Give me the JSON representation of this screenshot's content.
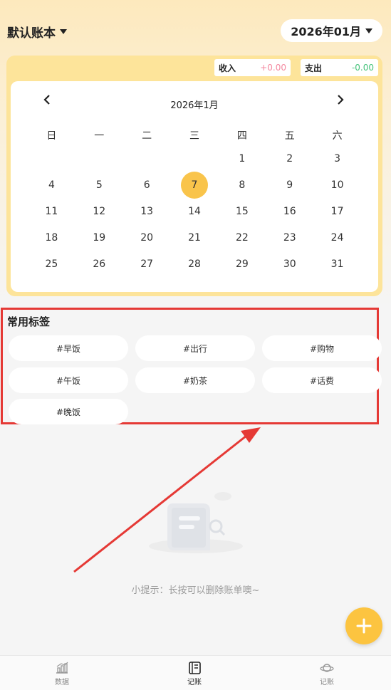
{
  "header": {
    "book_name": "默认账本",
    "month": "2026年01月"
  },
  "summary": {
    "income_label": "收入",
    "income_value": "+0.00",
    "expense_label": "支出",
    "expense_value": "-0.00"
  },
  "calendar": {
    "title": "2026年1月",
    "weekdays": [
      "日",
      "一",
      "二",
      "三",
      "四",
      "五",
      "六"
    ],
    "weeks": [
      [
        "",
        "",
        "",
        "",
        "1",
        "2",
        "3"
      ],
      [
        "4",
        "5",
        "6",
        "7",
        "8",
        "9",
        "10"
      ],
      [
        "11",
        "12",
        "13",
        "14",
        "15",
        "16",
        "17"
      ],
      [
        "18",
        "19",
        "20",
        "21",
        "22",
        "23",
        "24"
      ],
      [
        "25",
        "26",
        "27",
        "28",
        "29",
        "30",
        "31"
      ]
    ],
    "today": "7",
    "today_color": "#f9c44b"
  },
  "tags": {
    "title": "常用标签",
    "items": [
      "#早饭",
      "#出行",
      "#购物",
      "#午饭",
      "#奶茶",
      "#话费",
      "#晚饭"
    ]
  },
  "empty_state": {
    "tip": "小提示：长按可以删除账单噢~"
  },
  "fab": {
    "icon": "plus-icon"
  },
  "tabbar": {
    "items": [
      {
        "label": "数据",
        "icon": "chart-icon"
      },
      {
        "label": "记账",
        "icon": "notebook-icon"
      },
      {
        "label": "记账",
        "icon": "planet-icon"
      }
    ]
  },
  "colors": {
    "accent": "#fcc440",
    "card_bg": "#fde49a",
    "income": "#f48aa0",
    "expense": "#44c27a",
    "highlight_border": "#e53935"
  }
}
